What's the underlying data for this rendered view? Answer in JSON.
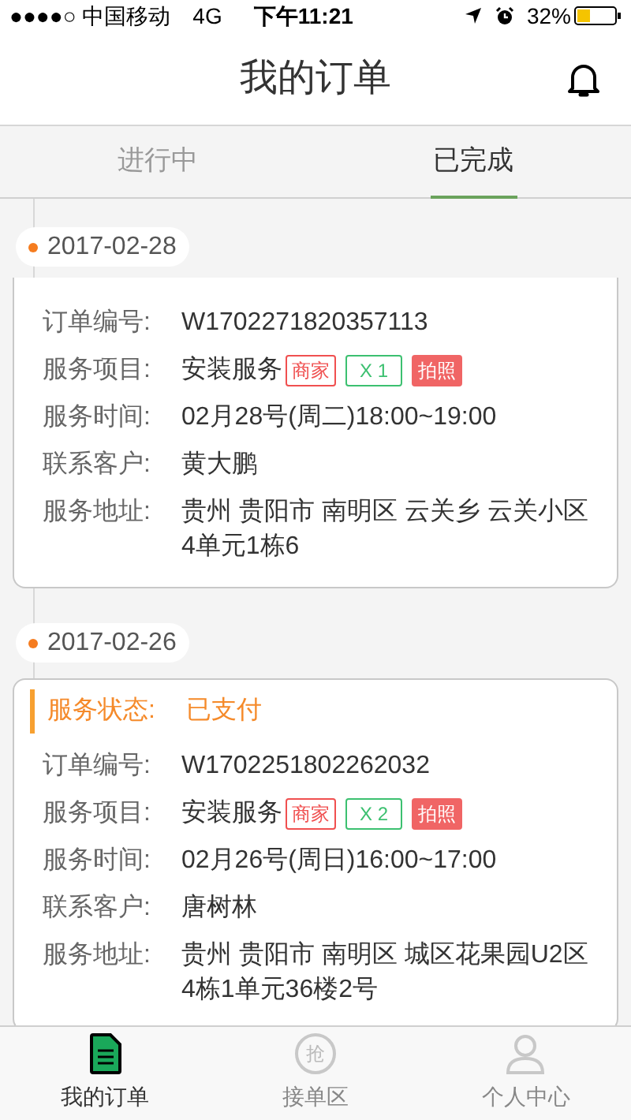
{
  "status_bar": {
    "carrier": "●●●●○ 中国移动",
    "network": "4G",
    "time": "下午11:21",
    "battery": "32%"
  },
  "header": {
    "title": "我的订单"
  },
  "tabs": [
    {
      "label": "进行中",
      "selected": false
    },
    {
      "label": "已完成",
      "selected": true
    }
  ],
  "groups": [
    {
      "date": "2017-02-28",
      "order": {
        "fields": [
          {
            "label": "订单编号:",
            "value": "W1702271820357113"
          },
          {
            "label": "服务项目:",
            "value": "安装服务",
            "tags": [
              {
                "text": "商家",
                "kind": "outline-red"
              },
              {
                "text": "X 1",
                "kind": "outline-green"
              },
              {
                "text": "拍照",
                "kind": "filled-red"
              }
            ]
          },
          {
            "label": "服务时间:",
            "value": "02月28号(周二)18:00~19:00"
          },
          {
            "label": "联系客户:",
            "value": "黄大鹏"
          },
          {
            "label": "服务地址:",
            "value": "贵州 贵阳市 南明区 云关乡 云关小区4单元1栋6"
          }
        ]
      }
    },
    {
      "date": "2017-02-26",
      "order": {
        "status_label": "服务状态:",
        "status": "已支付",
        "fields": [
          {
            "label": "订单编号:",
            "value": "W1702251802262032"
          },
          {
            "label": "服务项目:",
            "value": "安装服务",
            "tags": [
              {
                "text": "商家",
                "kind": "outline-red"
              },
              {
                "text": "X 2",
                "kind": "outline-green"
              },
              {
                "text": "拍照",
                "kind": "filled-red"
              }
            ]
          },
          {
            "label": "服务时间:",
            "value": "02月26号(周日)16:00~17:00"
          },
          {
            "label": "联系客户:",
            "value": "唐树林"
          },
          {
            "label": "服务地址:",
            "value": "贵州 贵阳市 南明区  城区花果园U2区4栋1单元36楼2号"
          }
        ]
      }
    }
  ],
  "bottom_nav": [
    {
      "label": "我的订单",
      "kind": "document",
      "selected": true
    },
    {
      "label": "接单区",
      "kind": "grab",
      "icon_text": "抢",
      "selected": false
    },
    {
      "label": "个人中心",
      "kind": "person",
      "selected": false
    }
  ]
}
